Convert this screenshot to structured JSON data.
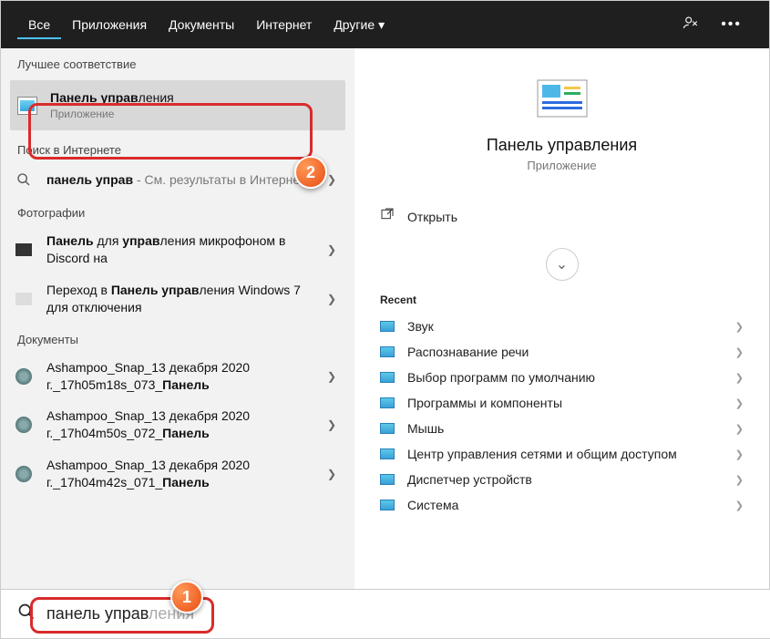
{
  "header": {
    "tabs": [
      "Все",
      "Приложения",
      "Документы",
      "Интернет",
      "Другие"
    ],
    "active_tab": 0
  },
  "sections": {
    "best_match": "Лучшее соответствие",
    "web": "Поиск в Интернете",
    "photos": "Фотографии",
    "documents": "Документы"
  },
  "best": {
    "title_bold": "Панель управ",
    "title_rest": "ления",
    "subtitle": "Приложение"
  },
  "web_result": {
    "prefix": "панель управ",
    "suffix": " - См. результаты в Интернете"
  },
  "photos": [
    {
      "pre": "Панель",
      "mid": " для ",
      "bold2": "управ",
      "post": "ления микрофоном в Discord на"
    },
    {
      "pre2": "Переход в ",
      "bold1": "Панель управ",
      "post": "ления Windows 7 для отключения"
    }
  ],
  "documents": [
    {
      "line1": "Ashampoo_Snap_13 декабря 2020 г._17h05m18s_073_",
      "bold": "Панель"
    },
    {
      "line1": "Ashampoo_Snap_13 декабря 2020 г._17h04m50s_072_",
      "bold": "Панель"
    },
    {
      "line1": "Ashampoo_Snap_13 декабря 2020 г._17h04m42s_071_",
      "bold": "Панель"
    }
  ],
  "detail": {
    "title": "Панель управления",
    "subtitle": "Приложение",
    "open_label": "Открыть",
    "recent_label": "Recent",
    "recent": [
      "Звук",
      "Распознавание речи",
      "Выбор программ по умолчанию",
      "Программы и компоненты",
      "Мышь",
      "Центр управления сетями и общим доступом",
      "Диспетчер устройств",
      "Система"
    ]
  },
  "search": {
    "typed": "панель управ",
    "ghost": "ления"
  },
  "callouts": {
    "one": "1",
    "two": "2"
  }
}
